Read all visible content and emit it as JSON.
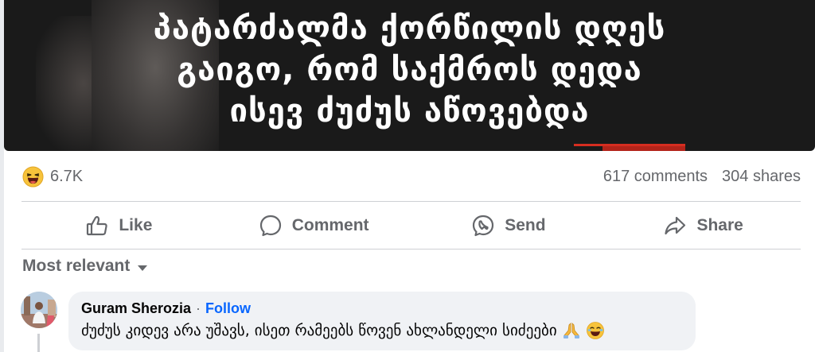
{
  "post": {
    "headline_lines": [
      "პატარძალმა ქორწილის დღეს",
      "გაიგო, რომ საქმროს დედა",
      "ისევ ძუძუს აწოვებდა"
    ],
    "reaction_count": "6.7K",
    "comments_count": "617 comments",
    "shares_count": "304 shares"
  },
  "actions": {
    "like": "Like",
    "comment": "Comment",
    "send": "Send",
    "share": "Share"
  },
  "comments_section": {
    "sort_label": "Most relevant",
    "comments": [
      {
        "author": "Guram Sherozia",
        "separator": "·",
        "follow_label": "Follow",
        "text": "ძუძუს კიდევ არა უშავს, ისეთ რამეებს წოვენ ახლანდელი სიძეები"
      }
    ]
  },
  "colors": {
    "accent": "#0866ff",
    "muted_text": "#65676b",
    "bubble_bg": "#f0f2f5",
    "image_bg": "#1a1a1a"
  },
  "icons": [
    "haha-reaction-icon",
    "like-icon",
    "comment-icon",
    "messenger-icon",
    "share-icon",
    "chevron-down-icon",
    "praying-hands-icon",
    "laughing-emoji-icon"
  ]
}
